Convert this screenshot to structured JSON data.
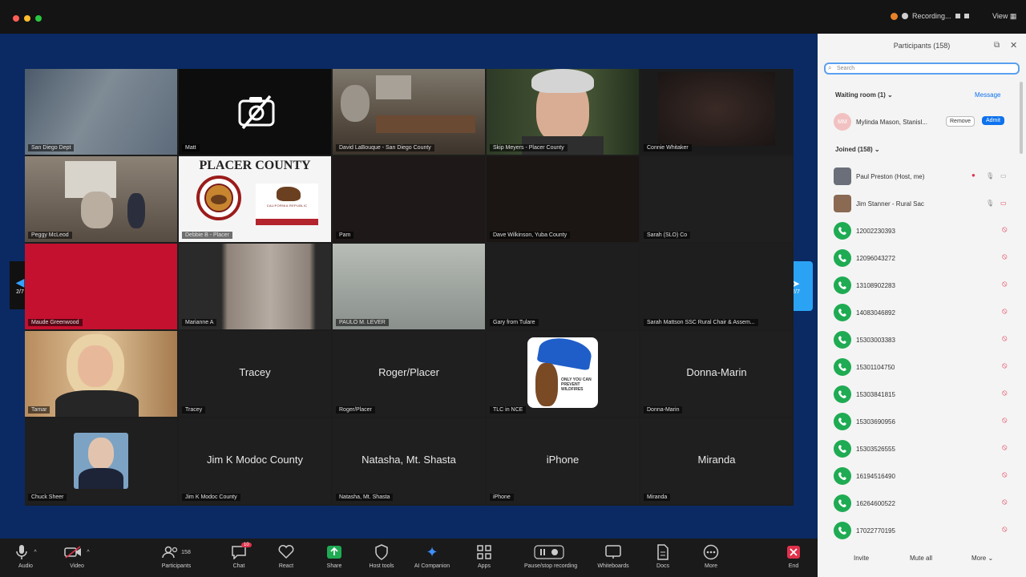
{
  "window": {
    "recording_label": "Recording...",
    "view_label": "View"
  },
  "nav": {
    "left_page": "2/7",
    "right_page": "2/7"
  },
  "tiles": [
    {
      "name": "San Diego Dept",
      "center": ""
    },
    {
      "name": "Matt",
      "center": ""
    },
    {
      "name": "David LaBouque - San Diego County",
      "center": ""
    },
    {
      "name": "Skip Meyers - Placer County",
      "center": ""
    },
    {
      "name": "Connie Whitaker",
      "center": ""
    },
    {
      "name": "Peggy McLeod",
      "center": ""
    },
    {
      "name": "Debbie B - Placer",
      "center": ""
    },
    {
      "name": "Pam",
      "center": ""
    },
    {
      "name": "Dave Wilkinson, Yuba County",
      "center": ""
    },
    {
      "name": "Sarah (SLO) Co",
      "center": ""
    },
    {
      "name": "Maude Greenwood",
      "center": ""
    },
    {
      "name": "Marianne A",
      "center": ""
    },
    {
      "name": "PAULO M. LEVER",
      "center": ""
    },
    {
      "name": "Gary from Tulare",
      "center": ""
    },
    {
      "name": "Sarah Mattson SSC Rural Chair & Assem...",
      "center": ""
    },
    {
      "name": "Tamar",
      "center": ""
    },
    {
      "name": "Tracey",
      "center": "Tracey"
    },
    {
      "name": "Roger/Placer",
      "center": "Roger/Placer"
    },
    {
      "name": "TLC in NCE",
      "center": ""
    },
    {
      "name": "Donna-Marin",
      "center": "Donna-Marin"
    },
    {
      "name": "Chuck Sheer",
      "center": ""
    },
    {
      "name": "Jim K Modoc County",
      "center": "Jim K Modoc County"
    },
    {
      "name": "Natasha, Mt. Shasta",
      "center": "Natasha, Mt. Shasta"
    },
    {
      "name": "iPhone",
      "center": "iPhone"
    },
    {
      "name": "Miranda",
      "center": "Miranda"
    }
  ],
  "placer_logo": {
    "title": "PLACER COUNTY",
    "flag_text": "CALIFORNIA REPUBLIC"
  },
  "bear_logo": {
    "text": "ONLY YOU CAN PREVENT WILDFIRES"
  },
  "toolbar": [
    {
      "label": "Audio",
      "icon": "microphone-icon"
    },
    {
      "label": "Video",
      "icon": "video-camera-icon"
    },
    {
      "label": "Participants",
      "icon": "participants-icon",
      "badge": "158"
    },
    {
      "label": "Chat",
      "icon": "chat-icon",
      "badge": "10"
    },
    {
      "label": "React",
      "icon": "heart-icon"
    },
    {
      "label": "Share",
      "icon": "share-screen-icon"
    },
    {
      "label": "Host tools",
      "icon": "shield-icon"
    },
    {
      "label": "AI Companion",
      "icon": "sparkle-icon"
    },
    {
      "label": "Apps",
      "icon": "apps-icon"
    },
    {
      "label": "Pause/stop recording",
      "icon": "pause-recording-icon"
    },
    {
      "label": "Whiteboards",
      "icon": "whiteboard-icon"
    },
    {
      "label": "Docs",
      "icon": "docs-icon"
    },
    {
      "label": "More",
      "icon": "more-icon"
    },
    {
      "label": "End",
      "icon": "end-icon"
    }
  ],
  "panel": {
    "title": "Participants (158)",
    "search_placeholder": "Search",
    "waiting_label": "Waiting room (1)",
    "message_label": "Message",
    "waiting_person": "Mylinda Mason, Stanisl...",
    "remove_label": "Remove",
    "admit_label": "Admit",
    "joined_label": "Joined (158)",
    "participants": [
      {
        "name": "Paul Preston (Host, me)",
        "type": "video"
      },
      {
        "name": "Jim Stanner - Rural Sac",
        "type": "video"
      },
      {
        "name": "12002230393",
        "type": "phone"
      },
      {
        "name": "12096043272",
        "type": "phone"
      },
      {
        "name": "13108902283",
        "type": "phone"
      },
      {
        "name": "14083046892",
        "type": "phone"
      },
      {
        "name": "15303003383",
        "type": "phone"
      },
      {
        "name": "15301104750",
        "type": "phone"
      },
      {
        "name": "15303841815",
        "type": "phone"
      },
      {
        "name": "15303690956",
        "type": "phone"
      },
      {
        "name": "15303526555",
        "type": "phone"
      },
      {
        "name": "16194516490",
        "type": "phone"
      },
      {
        "name": "16264600522",
        "type": "phone"
      },
      {
        "name": "17022770195",
        "type": "phone"
      }
    ],
    "invite_label": "Invite",
    "mute_all_label": "Mute all",
    "more_label": "More"
  },
  "colors": {
    "accent": "#0e72ed",
    "phone": "#1fab53",
    "muted": "#e0314b"
  }
}
